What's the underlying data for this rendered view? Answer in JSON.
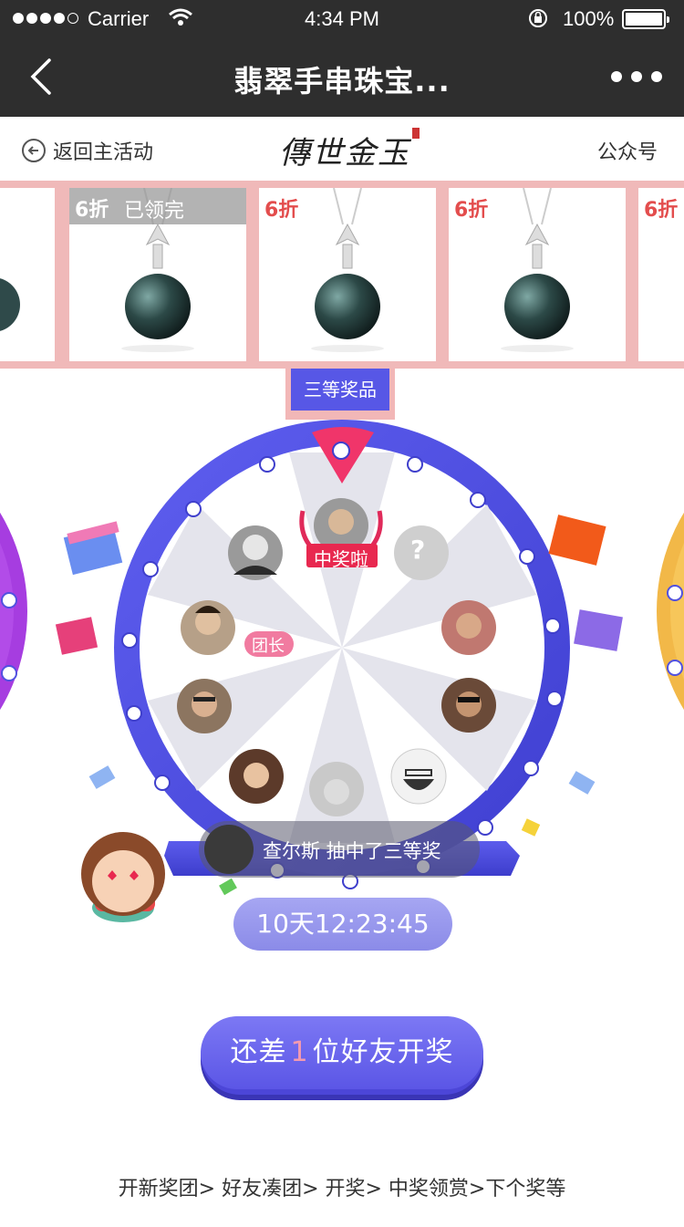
{
  "status_bar": {
    "carrier": "Carrier",
    "time": "4:34 PM",
    "battery": "100%",
    "icons": [
      "signal-dots-icon",
      "wifi-icon",
      "rotation-lock-icon",
      "battery-icon"
    ]
  },
  "nav": {
    "title": "翡翠手串珠宝...",
    "back_icon": "chevron-left-icon",
    "more_icon": "more-dots-icon"
  },
  "subheader": {
    "return_label": "返回主活动",
    "brand_logo": "傳世金玉",
    "follow_label": "公众号"
  },
  "products": [
    {
      "discount": "6折",
      "claimed": "已领完"
    },
    {
      "discount": "6折",
      "claimed": ""
    },
    {
      "discount": "6折",
      "claimed": ""
    },
    {
      "discount": "6折",
      "claimed": ""
    }
  ],
  "prize_tab": "三等奖品",
  "wheel": {
    "winner_badge": "中奖啦",
    "leader_badge": "团长",
    "unknown_slot": "?"
  },
  "winner_banner": "查尔斯 抽中了三等奖",
  "countdown": "10天12:23:45",
  "cta": {
    "prefix": "还差",
    "count": "1",
    "suffix": "位好友开奖"
  },
  "steps": "开新奖团> 好友凑团> 开奖> 中奖领赏>下个奖等",
  "colors": {
    "nav_bg": "#2e2e2e",
    "strip_bg": "#f0b9b9",
    "wheel_ring": "#5151e0",
    "cta": "#5b56e6",
    "discount_red": "#e34d4d",
    "pointer_pink": "#f0356a"
  }
}
